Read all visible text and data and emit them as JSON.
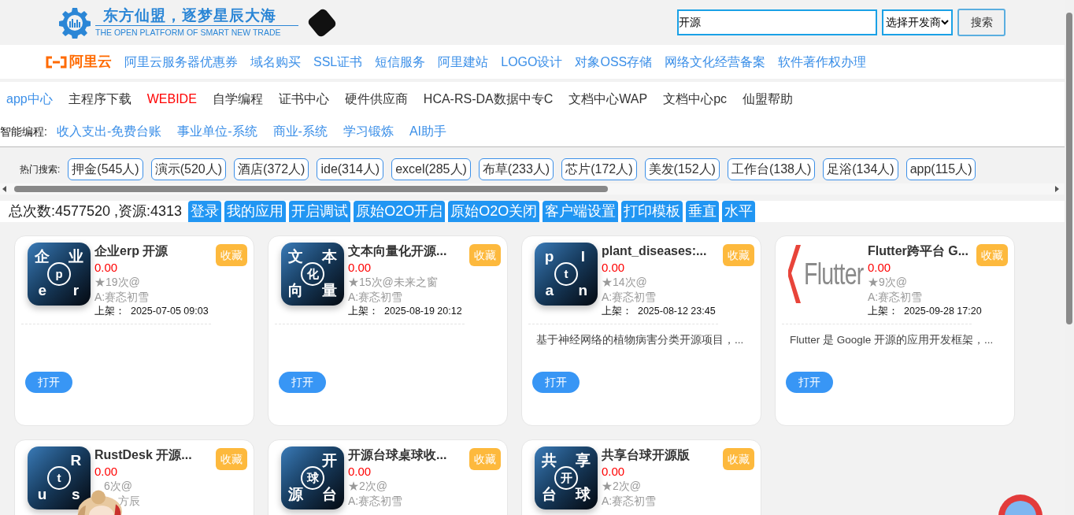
{
  "header": {
    "slogan": "东方仙盟，逐梦星辰大海",
    "tagline": "THE OPEN PLATFORM OF SMART NEW TRADE",
    "search": {
      "value": "开源"
    },
    "vendor_select": {
      "value": "选择开发商"
    },
    "search_button": "搜索"
  },
  "aliyun": {
    "brand": "阿里云",
    "links": [
      "阿里云服务器优惠券",
      "域名购买",
      "SSL证书",
      "短信服务",
      "阿里建站",
      "LOGO设计",
      "对象OSS存储",
      "网络文化经营备案",
      "软件著作权办理"
    ]
  },
  "nav": [
    {
      "label": "app中心",
      "kind": "accent"
    },
    {
      "label": "主程序下载",
      "kind": "plain"
    },
    {
      "label": "WEBIDE",
      "kind": "alert"
    },
    {
      "label": "自学编程",
      "kind": "plain"
    },
    {
      "label": "证书中心",
      "kind": "plain"
    },
    {
      "label": "硬件供应商",
      "kind": "plain"
    },
    {
      "label": "HCA-RS-DA数据中专C",
      "kind": "plain"
    },
    {
      "label": "文档中心WAP",
      "kind": "plain"
    },
    {
      "label": "文档中心pc",
      "kind": "plain"
    },
    {
      "label": "仙盟帮助",
      "kind": "plain"
    }
  ],
  "smart": {
    "label": "智能编程:",
    "links": [
      "收入支出-免费台账",
      "事业单位-系统",
      "商业-系统",
      "学习锻炼",
      "AI助手"
    ]
  },
  "hot": {
    "label": "热门搜索:",
    "tags": [
      "押金(545人)",
      "演示(520人)",
      "酒店(372人)",
      "ide(314人)",
      "excel(285人)",
      "布草(233人)",
      "芯片(172人)",
      "美发(152人)",
      "工作台(138人)",
      "足浴(134人)",
      "app(115人)"
    ]
  },
  "stats": {
    "text": "总次数:4577520 ,资源:4313",
    "buttons": [
      "登录",
      "我的应用",
      "开启调试",
      "原始O2O开启",
      "原始O2O关闭",
      "客户端设置",
      "打印模板",
      "垂直",
      "水平"
    ]
  },
  "cards": [
    {
      "icon": {
        "kind": "letters",
        "corners": {
          "top_left": "企",
          "top_right": "业",
          "bottom_left": "e",
          "bottom_right": "r"
        },
        "center": "p"
      },
      "title": "企业erp 开源",
      "price": "0.00",
      "views": "★19次@",
      "author": "A:赛忞初雪",
      "date_label": "上架：",
      "date": "2025-07-05 09:03",
      "fav": "收藏",
      "open": "打开"
    },
    {
      "icon": {
        "kind": "letters",
        "corners": {
          "top_left": "文",
          "top_right": "本",
          "bottom_left": "向",
          "bottom_right": "量"
        },
        "center": "化"
      },
      "title": "文本向量化开源...",
      "price": "0.00",
      "views": "★15次@未来之窗",
      "author": "A:赛忞初雪",
      "date_label": "上架：",
      "date": "2025-08-19 20:12",
      "fav": "收藏",
      "open": "打开"
    },
    {
      "icon": {
        "kind": "letters",
        "corners": {
          "top_left": "p",
          "top_right": "l",
          "bottom_left": "a",
          "bottom_right": "n"
        },
        "center": "t"
      },
      "title": "plant_diseases:...",
      "price": "0.00",
      "views": "★14次@",
      "author": "A:赛忞初雪",
      "date_label": "上架：",
      "date": "2025-08-12 23:45",
      "description": "基于神经网络的植物病害分类开源项目，...",
      "fav": "收藏",
      "open": "打开"
    },
    {
      "icon": {
        "kind": "logo",
        "text": "Flutter"
      },
      "title": "Flutter跨平台 G...",
      "price": "0.00",
      "views": "★9次@",
      "author": "A:赛忞初雪",
      "date_label": "上架：",
      "date": "2025-09-28 17:20",
      "description": "Flutter 是 Google 开源的应用开发框架，...",
      "fav": "收藏",
      "open": "打开"
    },
    {
      "icon": {
        "kind": "letters",
        "corners": {
          "top_right": "R",
          "bottom_left": "u",
          "bottom_right": "s"
        },
        "center": "t"
      },
      "title": "RustDesk 开源...",
      "price": "0.00",
      "views": "6次@",
      "author": "方辰",
      "fav": "收藏",
      "overlaid": true
    },
    {
      "icon": {
        "kind": "letters",
        "corners": {
          "top_right": "开",
          "bottom_left": "源",
          "bottom_right": "台"
        },
        "center": "球"
      },
      "title": "开源台球桌球收...",
      "price": "0.00",
      "views": "★2次@",
      "author": "A:赛忞初雪",
      "fav": "收藏"
    },
    {
      "icon": {
        "kind": "letters",
        "corners": {
          "top_left": "共",
          "top_right": "享",
          "bottom_left": "台",
          "bottom_right": "球"
        },
        "center": "开"
      },
      "title": "共享台球开源版",
      "price": "0.00",
      "views": "★2次@",
      "author": "A:赛忞初雪",
      "fav": "收藏"
    }
  ]
}
